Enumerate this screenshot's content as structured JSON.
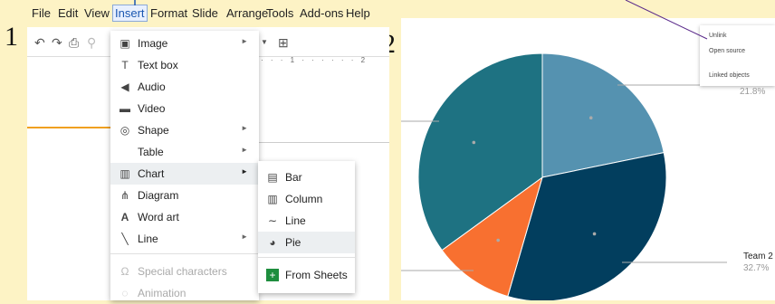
{
  "labels": {
    "panel1_number": "1",
    "panel2_number": "2"
  },
  "menubar": [
    "File",
    "Edit",
    "View",
    "Insert",
    "Format",
    "Slide",
    "Arrange",
    "Tools",
    "Add-ons",
    "Help"
  ],
  "insert_menu": {
    "items": [
      {
        "label": "Image",
        "icon": "image-icon",
        "submenu": true
      },
      {
        "label": "Text box",
        "icon": "text-box-icon",
        "submenu": false
      },
      {
        "label": "Audio",
        "icon": "audio-icon",
        "submenu": false
      },
      {
        "label": "Video",
        "icon": "video-icon",
        "submenu": false
      },
      {
        "label": "Shape",
        "icon": "shape-icon",
        "submenu": true
      },
      {
        "label": "Table",
        "icon": "",
        "submenu": true
      },
      {
        "label": "Chart",
        "icon": "chart-icon",
        "submenu": true,
        "highlighted": true
      },
      {
        "label": "Diagram",
        "icon": "diagram-icon",
        "submenu": false
      },
      {
        "label": "Word art",
        "icon": "word-art-icon",
        "submenu": false
      },
      {
        "label": "Line",
        "icon": "line-icon",
        "submenu": true
      },
      {
        "label": "Special characters",
        "icon": "special-characters-icon",
        "submenu": false,
        "disabled": true
      },
      {
        "label": "Animation",
        "icon": "animation-icon",
        "submenu": false,
        "disabled": true
      }
    ]
  },
  "chart_submenu": {
    "items": [
      {
        "label": "Bar",
        "icon": "bar-chart-icon"
      },
      {
        "label": "Column",
        "icon": "column-chart-icon"
      },
      {
        "label": "Line",
        "icon": "line-chart-icon"
      },
      {
        "label": "Pie",
        "icon": "pie-chart-icon",
        "highlighted": true
      },
      {
        "label": "From Sheets",
        "icon": "sheets-icon"
      }
    ]
  },
  "ruler": {
    "mark1": "1",
    "mark2": "2"
  },
  "panel2": {
    "context_menu": [
      "Unlink",
      "Open source",
      "Linked objects"
    ],
    "percent_top_right": "21.8%",
    "team_label": "Team 2",
    "percent_bottom_right": "32.7%"
  },
  "chart_data": {
    "type": "pie",
    "slices": [
      {
        "label": "",
        "value": 21.8,
        "color": "#5592b0"
      },
      {
        "label": "Team 2",
        "value": 32.7,
        "color": "#023e5e"
      },
      {
        "label": "",
        "value": 10.5,
        "color": "#f87030"
      },
      {
        "label": "",
        "value": 35.0,
        "color": "#1e7282"
      }
    ]
  },
  "colors": {
    "background": "#fdf3c5",
    "accent": "#1a56b0",
    "connector": "#5a2a8a"
  }
}
